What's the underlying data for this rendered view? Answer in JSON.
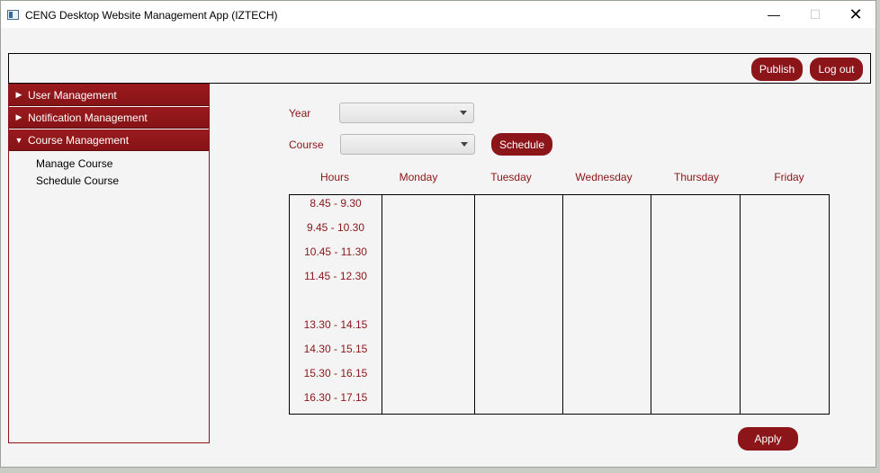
{
  "window": {
    "title": "CENG Desktop Website Management App (IZTECH)",
    "minimize_glyph": "—",
    "maximize_glyph": "☐",
    "close_glyph": "✕"
  },
  "topbar": {
    "publish_label": "Publish",
    "logout_label": "Log out"
  },
  "sidebar": {
    "items": [
      {
        "label": "User Management",
        "arrow": "▶"
      },
      {
        "label": "Notification Management",
        "arrow": "▶"
      },
      {
        "label": "Course Management",
        "arrow": "▼"
      }
    ],
    "sub_items": [
      "Manage Course",
      "Schedule Course"
    ]
  },
  "form": {
    "year_label": "Year",
    "course_label": "Course",
    "year_value": "",
    "course_value": "",
    "schedule_label": "Schedule",
    "apply_label": "Apply"
  },
  "timetable": {
    "columns": [
      "Hours",
      "Monday",
      "Tuesday",
      "Wednesday",
      "Thursday",
      "Friday"
    ],
    "hours": [
      "8.45 - 9.30",
      "9.45 - 10.30",
      "10.45 - 11.30",
      "11.45 - 12.30",
      "13.30 - 14.15",
      "14.30 - 15.15",
      "15.30 - 16.15",
      "16.30 - 17.15"
    ]
  },
  "colors": {
    "accent": "#8b1518",
    "background": "#f4f4f4"
  }
}
